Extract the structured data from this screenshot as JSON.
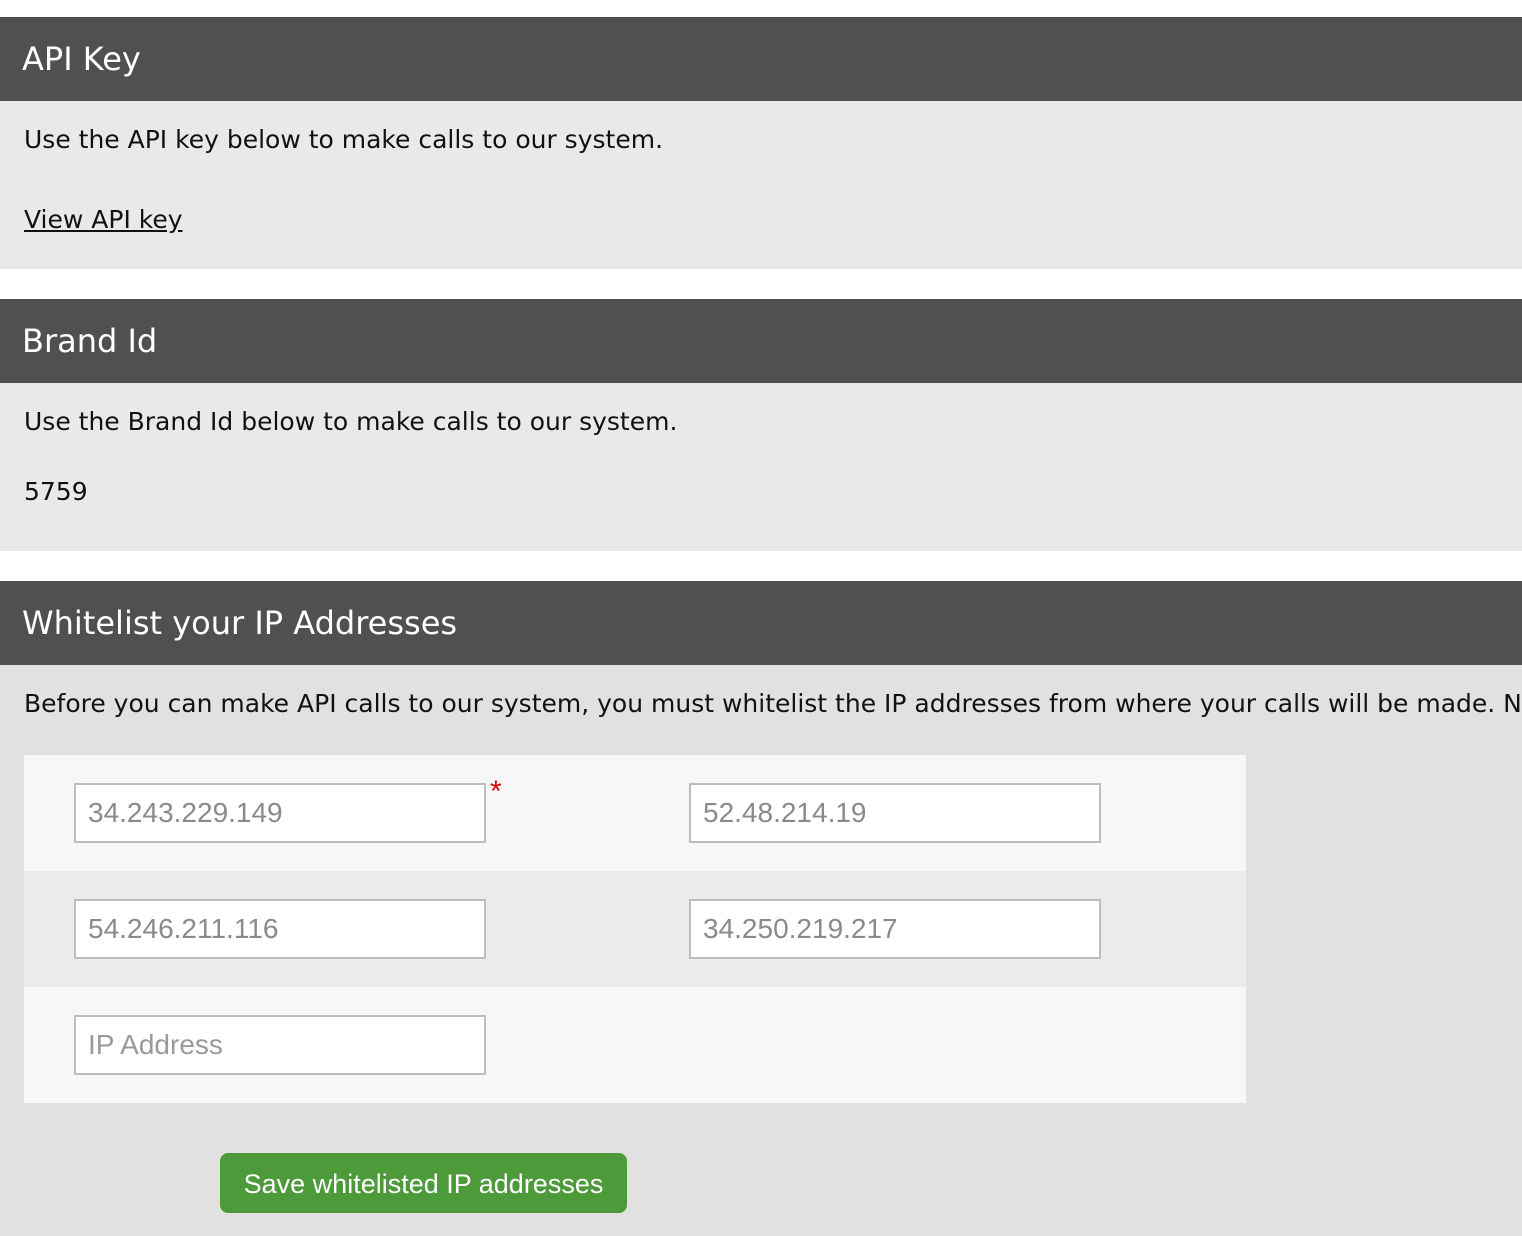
{
  "api_key": {
    "title": "API Key",
    "description": "Use the API key below to make calls to our system.",
    "view_link": "View API key"
  },
  "brand_id": {
    "title": "Brand Id",
    "description": "Use the Brand Id below to make calls to our system.",
    "value": "5759"
  },
  "whitelist": {
    "title": "Whitelist your IP Addresses",
    "description": "Before you can make API calls to our system, you must whitelist the IP addresses from where your calls will be made. Note: I",
    "ip_fields": [
      {
        "value": "34.243.229.149",
        "required": true
      },
      {
        "value": "52.48.214.19"
      },
      {
        "value": "54.246.211.116"
      },
      {
        "value": "34.250.219.217"
      },
      {
        "value": "",
        "placeholder": "IP Address"
      }
    ],
    "required_marker": "*",
    "save_button": "Save whitelisted IP addresses",
    "button_color": "#4c9a3a",
    "required_color": "#e00000"
  },
  "colors": {
    "header_bg": "#505050",
    "body_bg": "#e9e9e9"
  }
}
